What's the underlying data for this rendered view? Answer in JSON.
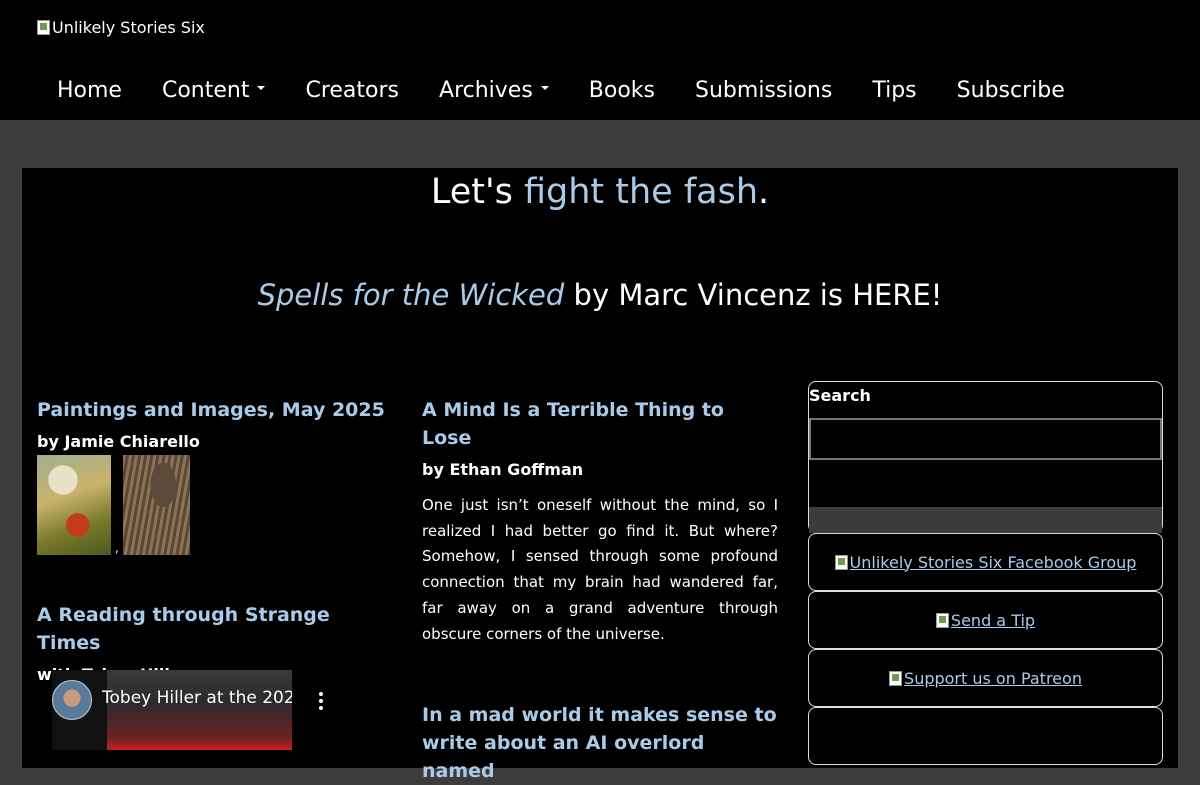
{
  "site": {
    "logo_alt": "Unlikely Stories Six"
  },
  "nav": {
    "items": [
      {
        "label": "Home"
      },
      {
        "label": "Content",
        "dropdown": true
      },
      {
        "label": "Creators"
      },
      {
        "label": "Archives",
        "dropdown": true
      },
      {
        "label": "Books"
      },
      {
        "label": "Submissions"
      },
      {
        "label": "Tips"
      },
      {
        "label": "Subscribe"
      }
    ]
  },
  "tagline": {
    "prefix": "Let's ",
    "link": "fight the fash",
    "suffix": "."
  },
  "announcement": {
    "book_title": "Spells for the Wicked",
    "rest": " by Marc Vincenz is HERE!"
  },
  "posts_left": [
    {
      "title": "Paintings and Images, May 2025",
      "byline": "by Jamie Chiarello",
      "separator": ","
    },
    {
      "title": "A Reading through Strange Times",
      "byline": "with Tobey Hiller",
      "video_title": "Tobey Hiller at the 202..."
    }
  ],
  "posts_right": [
    {
      "title": "A Mind Is a Terrible Thing to Lose",
      "byline": "by Ethan Goffman",
      "excerpt": "One just isn’t oneself without the mind, so I realized I had better go find it. But where? Somehow, I sensed through some profound connection that my brain had wandered far, far away on a grand adventure through obscure corners of the universe."
    },
    {
      "title": "In a mad world it makes sense to write about an AI overlord named"
    }
  ],
  "sidebar": {
    "search_label": "Search",
    "links": [
      {
        "label": "Unlikely Stories Six Facebook Group"
      },
      {
        "label": "Send a Tip"
      },
      {
        "label": "Support us on Patreon"
      }
    ]
  },
  "colors": {
    "accent": "#a9cbe8",
    "page_bg": "#3c3c3c",
    "panel_bg": "#000000"
  }
}
